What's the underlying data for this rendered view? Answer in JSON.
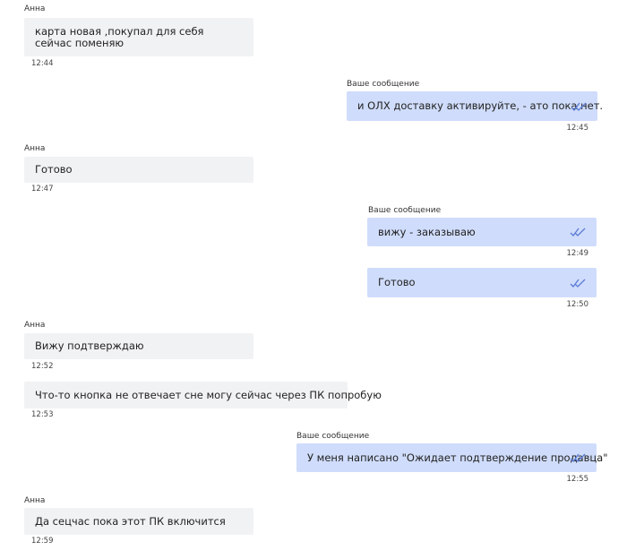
{
  "messages": [
    {
      "sender": "Анна",
      "text_lines": [
        "карта новая ,покупал для себя",
        "сейчас поменяю"
      ],
      "time": "12:44"
    },
    {
      "sender": "Ваше сообщение",
      "text_lines": [
        "и ОЛХ доставку активируйте, - ато пока нет."
      ],
      "time": "12:45"
    },
    {
      "sender": "Анна",
      "text_lines": [
        "Готово"
      ],
      "time": "12:47"
    },
    {
      "sender": "Ваше сообщение",
      "text_lines": [
        "вижу - заказываю"
      ],
      "time": "12:49"
    },
    {
      "sender": "",
      "text_lines": [
        "Готово"
      ],
      "time": "12:50"
    },
    {
      "sender": "Анна",
      "text_lines": [
        "Вижу подтверждаю"
      ],
      "time": "12:52"
    },
    {
      "sender": "",
      "text_lines": [
        "Что-то кнопка не отвечает сне могу сейчас через ПК попробую"
      ],
      "time": "12:53"
    },
    {
      "sender": "Ваше сообщение",
      "text_lines": [
        "У меня написано \"Ожидает подтверждение продавца\""
      ],
      "time": "12:55"
    },
    {
      "sender": "Анна",
      "text_lines": [
        "Да сецчас пока этот ПК включится"
      ],
      "time": "12:59"
    }
  ],
  "icons": {
    "read_receipt": "double-check-icon"
  },
  "colors": {
    "incoming_bubble": "#f1f2f4",
    "outgoing_bubble": "#cfdcfb",
    "read_ticks": "#5b7bd5"
  }
}
